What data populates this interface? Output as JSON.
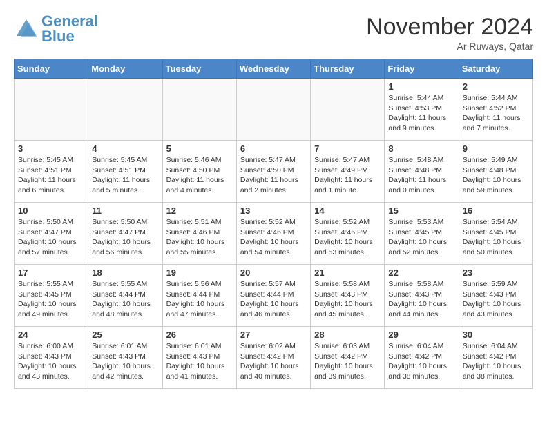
{
  "header": {
    "logo_general": "General",
    "logo_blue": "Blue",
    "month_title": "November 2024",
    "location": "Ar Ruways, Qatar"
  },
  "weekdays": [
    "Sunday",
    "Monday",
    "Tuesday",
    "Wednesday",
    "Thursday",
    "Friday",
    "Saturday"
  ],
  "weeks": [
    [
      {
        "day": "",
        "info": ""
      },
      {
        "day": "",
        "info": ""
      },
      {
        "day": "",
        "info": ""
      },
      {
        "day": "",
        "info": ""
      },
      {
        "day": "",
        "info": ""
      },
      {
        "day": "1",
        "info": "Sunrise: 5:44 AM\nSunset: 4:53 PM\nDaylight: 11 hours\nand 9 minutes."
      },
      {
        "day": "2",
        "info": "Sunrise: 5:44 AM\nSunset: 4:52 PM\nDaylight: 11 hours\nand 7 minutes."
      }
    ],
    [
      {
        "day": "3",
        "info": "Sunrise: 5:45 AM\nSunset: 4:51 PM\nDaylight: 11 hours\nand 6 minutes."
      },
      {
        "day": "4",
        "info": "Sunrise: 5:45 AM\nSunset: 4:51 PM\nDaylight: 11 hours\nand 5 minutes."
      },
      {
        "day": "5",
        "info": "Sunrise: 5:46 AM\nSunset: 4:50 PM\nDaylight: 11 hours\nand 4 minutes."
      },
      {
        "day": "6",
        "info": "Sunrise: 5:47 AM\nSunset: 4:50 PM\nDaylight: 11 hours\nand 2 minutes."
      },
      {
        "day": "7",
        "info": "Sunrise: 5:47 AM\nSunset: 4:49 PM\nDaylight: 11 hours\nand 1 minute."
      },
      {
        "day": "8",
        "info": "Sunrise: 5:48 AM\nSunset: 4:48 PM\nDaylight: 11 hours\nand 0 minutes."
      },
      {
        "day": "9",
        "info": "Sunrise: 5:49 AM\nSunset: 4:48 PM\nDaylight: 10 hours\nand 59 minutes."
      }
    ],
    [
      {
        "day": "10",
        "info": "Sunrise: 5:50 AM\nSunset: 4:47 PM\nDaylight: 10 hours\nand 57 minutes."
      },
      {
        "day": "11",
        "info": "Sunrise: 5:50 AM\nSunset: 4:47 PM\nDaylight: 10 hours\nand 56 minutes."
      },
      {
        "day": "12",
        "info": "Sunrise: 5:51 AM\nSunset: 4:46 PM\nDaylight: 10 hours\nand 55 minutes."
      },
      {
        "day": "13",
        "info": "Sunrise: 5:52 AM\nSunset: 4:46 PM\nDaylight: 10 hours\nand 54 minutes."
      },
      {
        "day": "14",
        "info": "Sunrise: 5:52 AM\nSunset: 4:46 PM\nDaylight: 10 hours\nand 53 minutes."
      },
      {
        "day": "15",
        "info": "Sunrise: 5:53 AM\nSunset: 4:45 PM\nDaylight: 10 hours\nand 52 minutes."
      },
      {
        "day": "16",
        "info": "Sunrise: 5:54 AM\nSunset: 4:45 PM\nDaylight: 10 hours\nand 50 minutes."
      }
    ],
    [
      {
        "day": "17",
        "info": "Sunrise: 5:55 AM\nSunset: 4:45 PM\nDaylight: 10 hours\nand 49 minutes."
      },
      {
        "day": "18",
        "info": "Sunrise: 5:55 AM\nSunset: 4:44 PM\nDaylight: 10 hours\nand 48 minutes."
      },
      {
        "day": "19",
        "info": "Sunrise: 5:56 AM\nSunset: 4:44 PM\nDaylight: 10 hours\nand 47 minutes."
      },
      {
        "day": "20",
        "info": "Sunrise: 5:57 AM\nSunset: 4:44 PM\nDaylight: 10 hours\nand 46 minutes."
      },
      {
        "day": "21",
        "info": "Sunrise: 5:58 AM\nSunset: 4:43 PM\nDaylight: 10 hours\nand 45 minutes."
      },
      {
        "day": "22",
        "info": "Sunrise: 5:58 AM\nSunset: 4:43 PM\nDaylight: 10 hours\nand 44 minutes."
      },
      {
        "day": "23",
        "info": "Sunrise: 5:59 AM\nSunset: 4:43 PM\nDaylight: 10 hours\nand 43 minutes."
      }
    ],
    [
      {
        "day": "24",
        "info": "Sunrise: 6:00 AM\nSunset: 4:43 PM\nDaylight: 10 hours\nand 43 minutes."
      },
      {
        "day": "25",
        "info": "Sunrise: 6:01 AM\nSunset: 4:43 PM\nDaylight: 10 hours\nand 42 minutes."
      },
      {
        "day": "26",
        "info": "Sunrise: 6:01 AM\nSunset: 4:43 PM\nDaylight: 10 hours\nand 41 minutes."
      },
      {
        "day": "27",
        "info": "Sunrise: 6:02 AM\nSunset: 4:42 PM\nDaylight: 10 hours\nand 40 minutes."
      },
      {
        "day": "28",
        "info": "Sunrise: 6:03 AM\nSunset: 4:42 PM\nDaylight: 10 hours\nand 39 minutes."
      },
      {
        "day": "29",
        "info": "Sunrise: 6:04 AM\nSunset: 4:42 PM\nDaylight: 10 hours\nand 38 minutes."
      },
      {
        "day": "30",
        "info": "Sunrise: 6:04 AM\nSunset: 4:42 PM\nDaylight: 10 hours\nand 38 minutes."
      }
    ]
  ]
}
